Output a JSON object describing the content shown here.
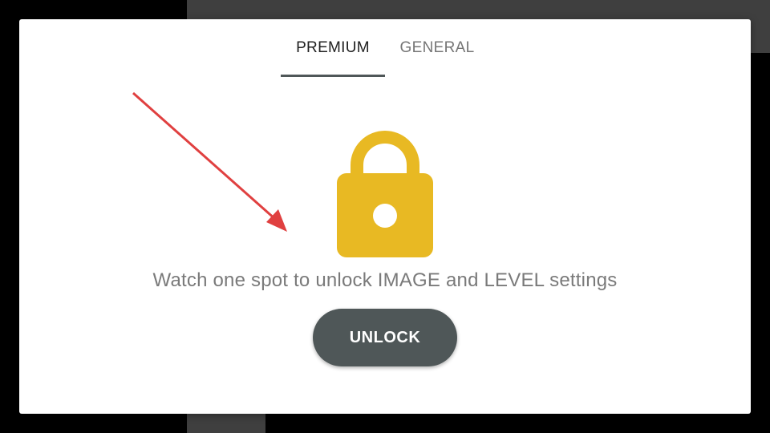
{
  "tabs": {
    "premium_label": "PREMIUM",
    "general_label": "GENERAL",
    "active": "premium"
  },
  "content": {
    "icon": "lock-icon",
    "message": "Watch one spot to unlock IMAGE and LEVEL settings",
    "unlock_label": "UNLOCK"
  },
  "annotation": {
    "icon": "red-arrow"
  },
  "colors": {
    "lock": "#e8b923",
    "button": "#4f5758",
    "tab_indicator": "#4f5758",
    "arrow": "#e04040",
    "message_text": "#7a7a7a"
  }
}
